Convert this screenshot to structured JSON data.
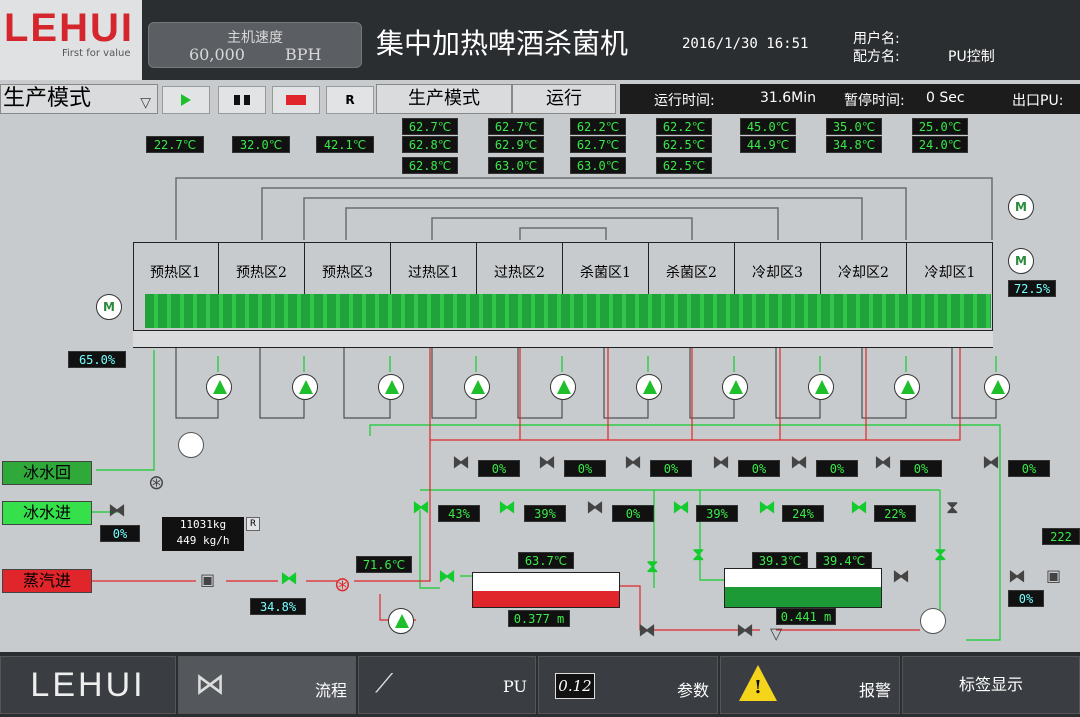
{
  "header": {
    "logo_text": "LEHUI",
    "logo_slogan": "First for value",
    "speed_label": "主机速度",
    "speed_value": "60,000",
    "speed_unit": "BPH",
    "title": "集中加热啤酒杀菌机",
    "datetime": "2016/1/30  16:51",
    "user_label": "用户名:",
    "recipe_label": "配方名:",
    "recipe_value": "PU控制"
  },
  "toolbar": {
    "mode_select": "生产模式",
    "mode_button": "生产模式",
    "run_button": "运行",
    "run_time_label": "运行时间:",
    "run_time_value": "31.6Min",
    "pause_time_label": "暂停时间:",
    "pause_time_value": "0 Sec",
    "exit_pu_label": "出口PU:",
    "reset_glyph": "R"
  },
  "temps": {
    "top_row": [
      "62.7℃",
      "62.7℃",
      "62.2℃",
      "62.2℃",
      "45.0℃",
      "35.0℃",
      "25.0℃"
    ],
    "mid_row": [
      "22.7℃",
      "32.0℃",
      "42.1℃",
      "62.8℃",
      "62.9℃",
      "62.7℃",
      "62.5℃",
      "44.9℃",
      "34.8℃",
      "24.0℃"
    ],
    "low_row": [
      "62.8℃",
      "63.0℃",
      "63.0℃",
      "62.5℃"
    ]
  },
  "zones": [
    "预热区1",
    "预热区2",
    "预热区3",
    "过热区1",
    "过热区2",
    "杀菌区1",
    "杀菌区2",
    "冷却区3",
    "冷却区2",
    "冷却区1"
  ],
  "machine": {
    "motor_glyph": "M",
    "left_belt_pct": "65.0%",
    "right_pct": "72.5%"
  },
  "valves": {
    "upper_row": [
      "0%",
      "0%",
      "0%",
      "0%",
      "0%",
      "0%",
      "0%"
    ],
    "lower_row": [
      "43%",
      "39%",
      "0%",
      "39%",
      "24%",
      "22%"
    ],
    "cold_in": "0%",
    "steam": "34.8%",
    "right": "0%"
  },
  "utilities": {
    "ice_return": "冰水回",
    "ice_in": "冰水进",
    "steam_in": "蒸汽进",
    "flow_total": "11031kg",
    "flow_rate": "449 kg/h",
    "reset": "R",
    "right_flow": "222"
  },
  "hot_circuit": {
    "hx_temp": "71.6℃",
    "tank_temp": "63.7℃",
    "tank_level": "0.377 m"
  },
  "cold_circuit": {
    "temp_a": "39.3℃",
    "temp_b": "39.4℃",
    "tank_level": "0.441 m"
  },
  "bottom_nav": {
    "logo": "LEHUI",
    "flow": "流程",
    "pu": "PU",
    "pu_value": "0.12",
    "params": "参数",
    "alarm": "报警",
    "labels": "标签显示"
  },
  "colors": {
    "green": "#11cc2c",
    "red": "#e0262a",
    "dark": "#2b2e31"
  }
}
